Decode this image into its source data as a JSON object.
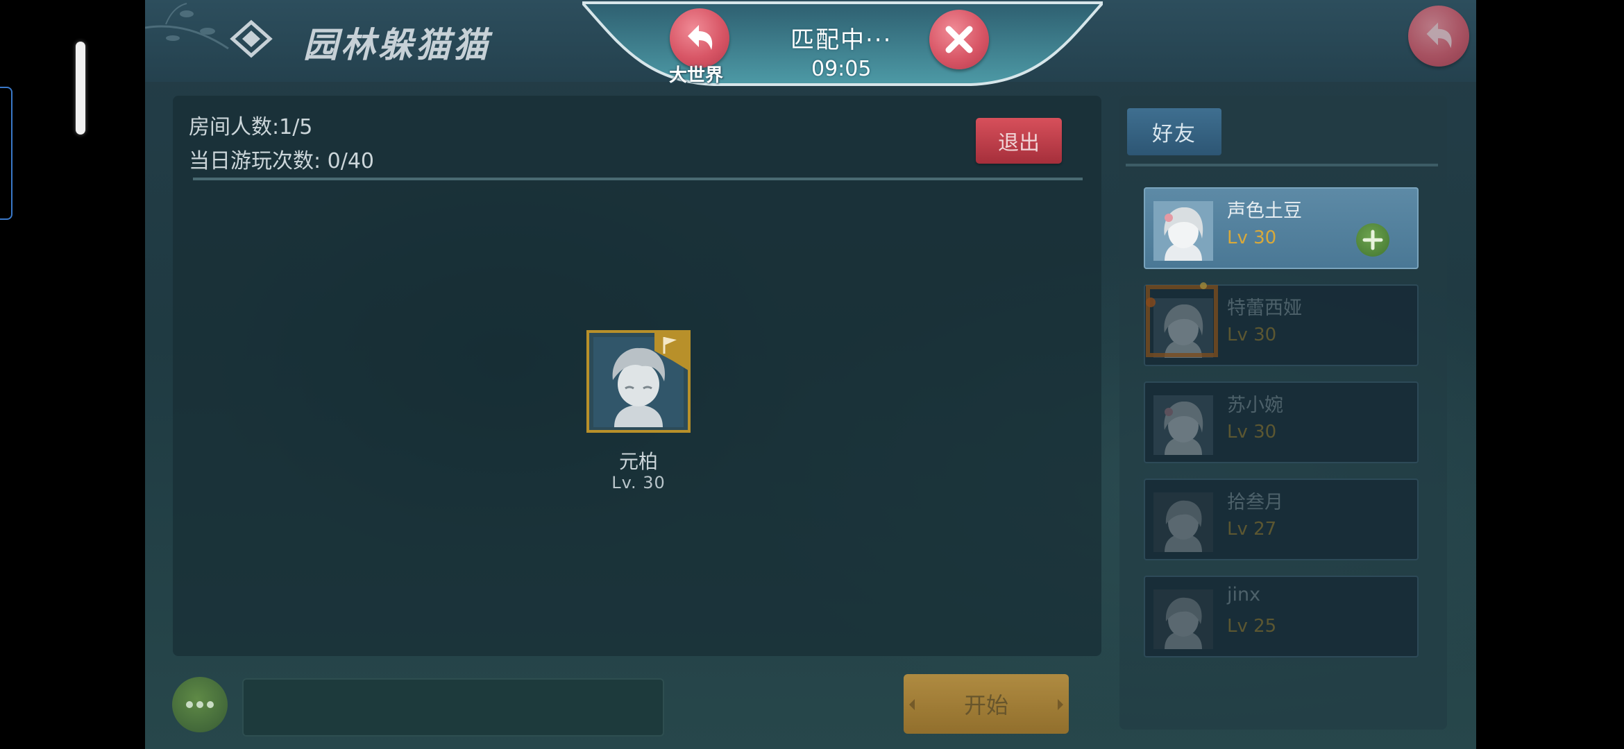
{
  "header": {
    "game_title": "园林躲猫猫",
    "back_world_label": "大世界",
    "match_status": "匹配中···",
    "match_timer": "09:05"
  },
  "room": {
    "room_count": "房间人数:1/5",
    "play_count": "当日游玩次数: 0/40",
    "exit_label": "退出"
  },
  "player": {
    "name": "元柏",
    "level": "Lv. 30"
  },
  "bottom": {
    "start_label": "开始"
  },
  "friends": {
    "tab_label": "好友",
    "items": [
      {
        "name": "声色土豆",
        "level": "Lv 30"
      },
      {
        "name": "特蕾西娅",
        "level": "Lv 30"
      },
      {
        "name": "苏小婉",
        "level": "Lv 30"
      },
      {
        "name": "拾叁月",
        "level": "Lv 27"
      },
      {
        "name": "jinx",
        "level": "Lv 25"
      }
    ]
  },
  "colors": {
    "primary_button": "#d85666",
    "start_button": "#d69f3f",
    "level_text": "#d9a93a",
    "frame_gold": "#b8902a"
  },
  "icons": {
    "back": "back-arrow-icon",
    "close": "close-icon",
    "add": "plus-icon",
    "more": "ellipsis-icon",
    "flag": "flag-icon",
    "logo": "game-logo-icon"
  }
}
